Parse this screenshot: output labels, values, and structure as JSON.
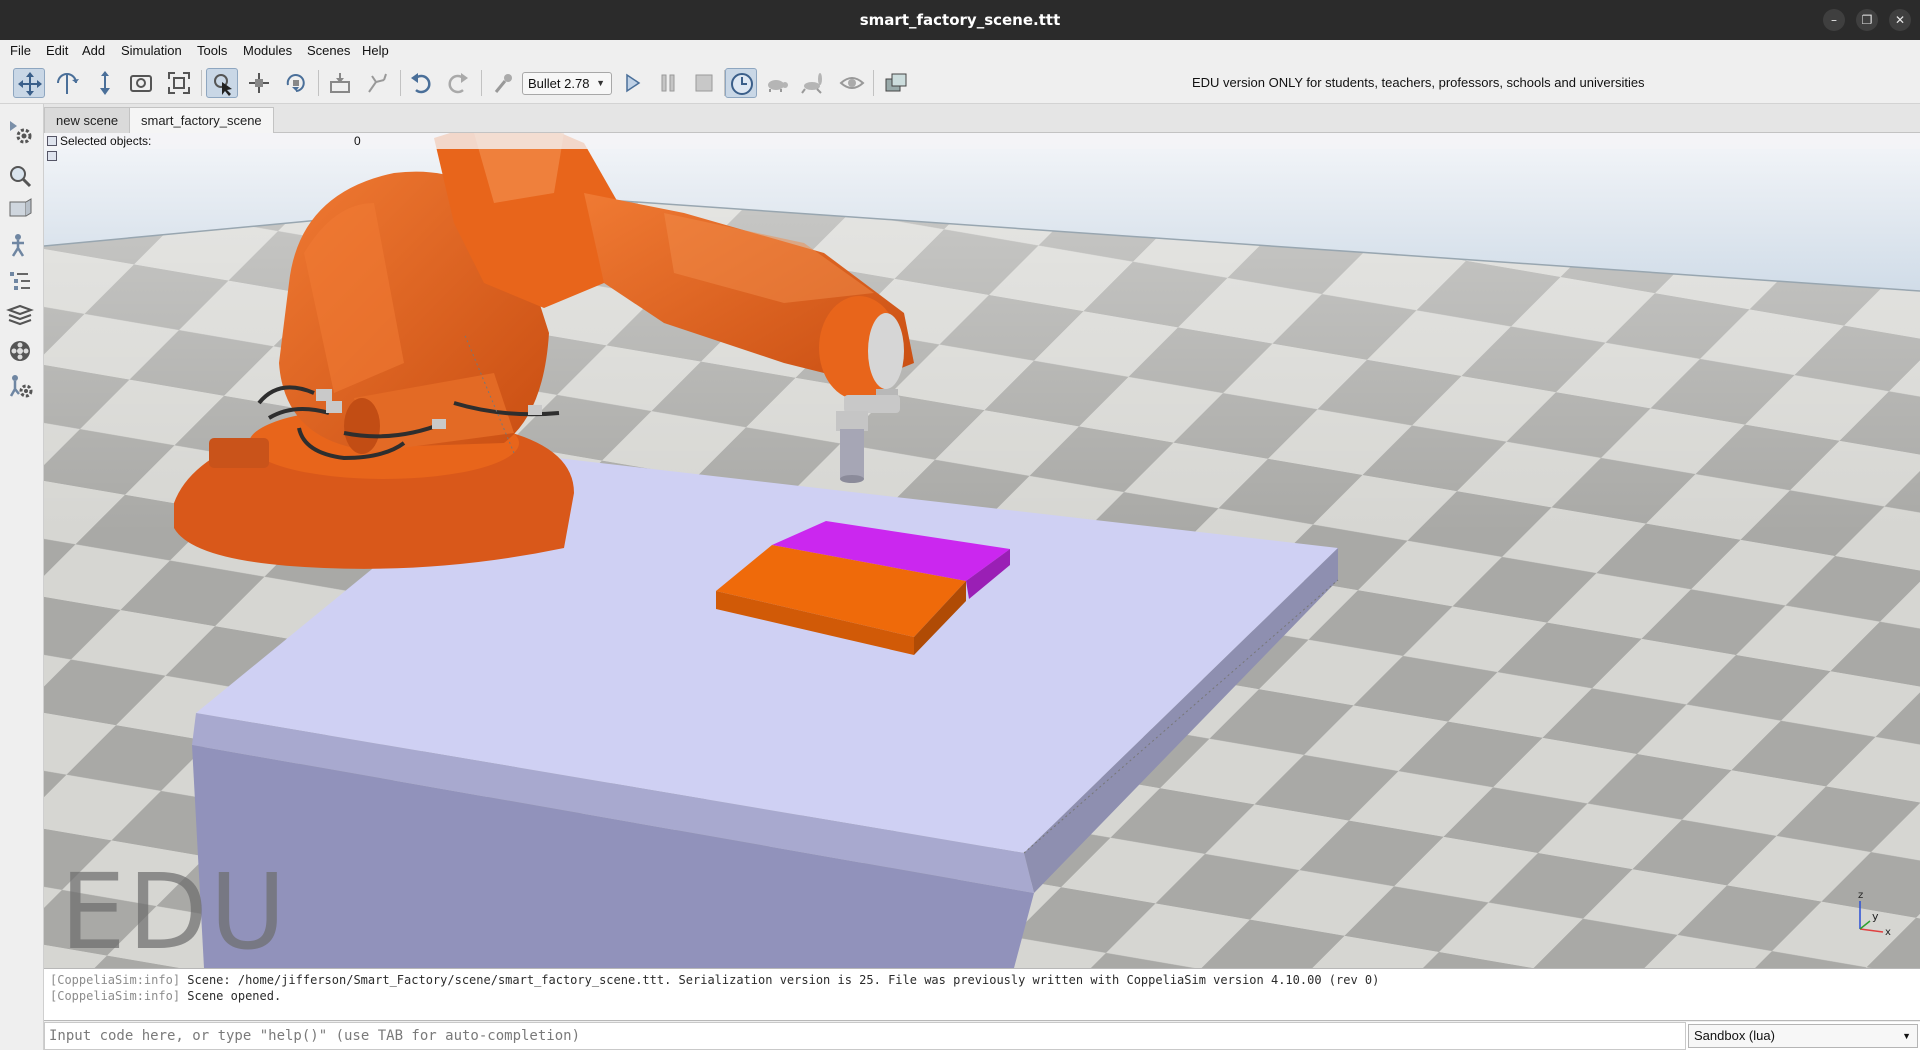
{
  "window": {
    "title": "smart_factory_scene.ttt",
    "minimize_glyph": "–",
    "restore_glyph": "❐",
    "close_glyph": "✕"
  },
  "menu": [
    "File",
    "Edit",
    "Add",
    "Simulation",
    "Tools",
    "Modules",
    "Scenes",
    "Help"
  ],
  "toolbar": {
    "physics_engine": "Bullet 2.78",
    "edu_notice": "EDU version ONLY for students, teachers, professors, schools and universities",
    "icons": [
      "move-camera-icon",
      "rotate-camera-icon",
      "shift-camera-icon",
      "zoom-camera-icon",
      "fit-to-view-icon",
      "click-select-icon",
      "object-shift-icon",
      "object-rotate-icon",
      "assemble-icon",
      "transfer-dna-icon",
      "undo-icon",
      "redo-icon",
      "dynamics-icon",
      "play-icon",
      "pause-icon",
      "stop-icon",
      "realtime-icon",
      "slow-down-icon",
      "speed-up-icon",
      "visualization-icon",
      "page-selector-icon"
    ]
  },
  "left_toolbar": {
    "icons": [
      "simulation-settings-icon",
      "model-browser-icon",
      "scene-hierarchy-icon",
      "calculation-modules-icon",
      "collections-icon",
      "layers-icon",
      "selection-icon",
      "user-settings-icon"
    ]
  },
  "tabs": [
    {
      "label": "new scene",
      "active": false
    },
    {
      "label": "smart_factory_scene",
      "active": true
    }
  ],
  "viewport": {
    "selected_label": "Selected objects:",
    "selected_count": "0",
    "watermark": "EDU",
    "axes": {
      "z": "z",
      "y": "y",
      "x": "x"
    },
    "colors": {
      "floor_light": "#d8d7d3",
      "floor_dark": "#a4a4a1",
      "sky": "#a9c0d6",
      "robot": "#e8651b",
      "table_top": "#cfd0f3",
      "block_magenta": "#cb27ef",
      "block_orange": "#ef6a0a"
    }
  },
  "console": {
    "lines": [
      {
        "tag": "[CoppeliaSim:info]",
        "text": "Scene: /home/jifferson/Smart_Factory/scene/smart_factory_scene.ttt. Serialization version is 25. File was previously written with CoppeliaSim version 4.10.00 (rev 0)"
      },
      {
        "tag": "[CoppeliaSim:info]",
        "text": "Scene opened."
      }
    ]
  },
  "input": {
    "placeholder": "Input code here, or type \"help()\" (use TAB for auto-completion)",
    "value": "",
    "sandbox": "Sandbox (lua)"
  }
}
